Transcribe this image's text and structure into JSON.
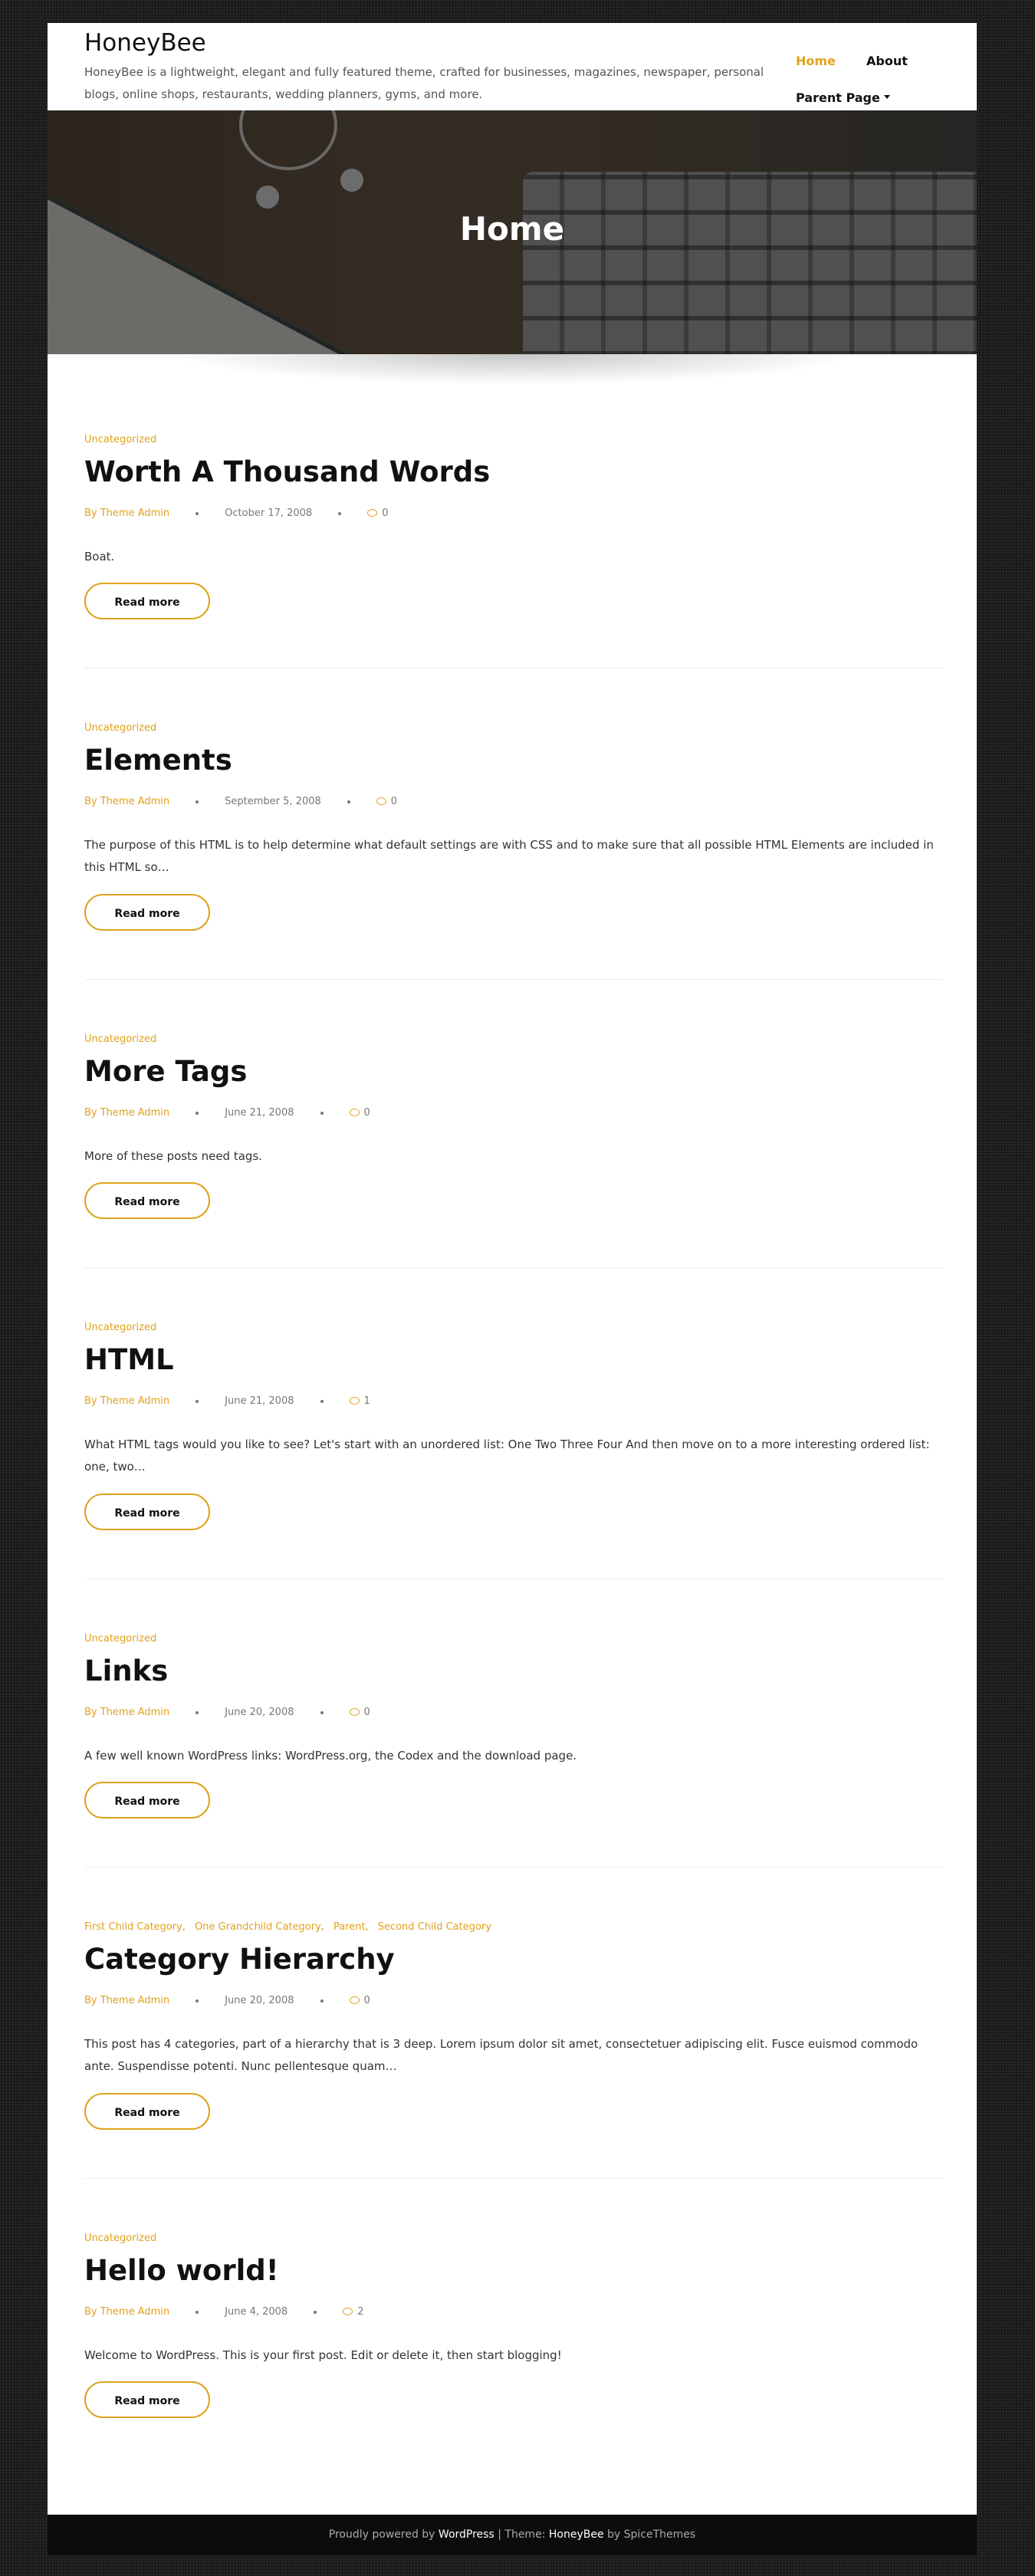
{
  "header": {
    "site_title": "HoneyBee",
    "site_description": "HoneyBee is a lightweight, elegant and fully featured theme, crafted for businesses, magazines, newspaper, personal blogs, online shops, restaurants, wedding planners, gyms, and more.",
    "nav": [
      {
        "label": "Home",
        "active": true
      },
      {
        "label": "About",
        "active": false
      },
      {
        "label": "Parent Page",
        "active": false,
        "dropdown": true
      }
    ]
  },
  "hero": {
    "title": "Home"
  },
  "colors": {
    "accent": "#e0a11b",
    "text": "#111111",
    "footer_bg": "#0c0c0c"
  },
  "read_more_label": "Read more",
  "posts": [
    {
      "categories": [
        "Uncategorized"
      ],
      "title": "Worth A Thousand Words",
      "author": "By Theme Admin",
      "date": "October 17, 2008",
      "comments": "0",
      "excerpt": "Boat."
    },
    {
      "categories": [
        "Uncategorized"
      ],
      "title": "Elements",
      "author": "By Theme Admin",
      "date": "September 5, 2008",
      "comments": "0",
      "excerpt": "The purpose of this HTML is to help determine what default settings are with CSS and to make sure that all possible HTML Elements are included in this HTML so…"
    },
    {
      "categories": [
        "Uncategorized"
      ],
      "title": "More Tags",
      "author": "By Theme Admin",
      "date": "June 21, 2008",
      "comments": "0",
      "excerpt": "More of these posts need tags."
    },
    {
      "categories": [
        "Uncategorized"
      ],
      "title": "HTML",
      "author": "By Theme Admin",
      "date": "June 21, 2008",
      "comments": "1",
      "excerpt": "What HTML tags would you like to see? Let's start with an unordered list: One Two Three Four And then move on to a more interesting ordered list: one, two…"
    },
    {
      "categories": [
        "Uncategorized"
      ],
      "title": "Links",
      "author": "By Theme Admin",
      "date": "June 20, 2008",
      "comments": "0",
      "excerpt": "A few well known WordPress links: WordPress.org, the Codex and the download page."
    },
    {
      "categories": [
        "First Child Category,",
        "One Grandchild Category,",
        "Parent,",
        "Second Child Category"
      ],
      "title": "Category Hierarchy",
      "author": "By Theme Admin",
      "date": "June 20, 2008",
      "comments": "0",
      "excerpt": "This post has 4 categories, part of a hierarchy that is 3 deep. Lorem ipsum dolor sit amet, consectetuer adipiscing elit. Fusce euismod commodo ante. Suspendisse potenti. Nunc pellentesque quam…"
    },
    {
      "categories": [
        "Uncategorized"
      ],
      "title": "Hello world!",
      "author": "By Theme Admin",
      "date": "June 4, 2008",
      "comments": "2",
      "excerpt": "Welcome to WordPress. This is your first post. Edit or delete it, then start blogging!"
    }
  ],
  "footer": {
    "powered_prefix": "Proudly powered by",
    "powered_link": "WordPress",
    "separator": "|",
    "theme_prefix": "Theme:",
    "theme_link": "HoneyBee",
    "by_text": "by SpiceThemes"
  }
}
